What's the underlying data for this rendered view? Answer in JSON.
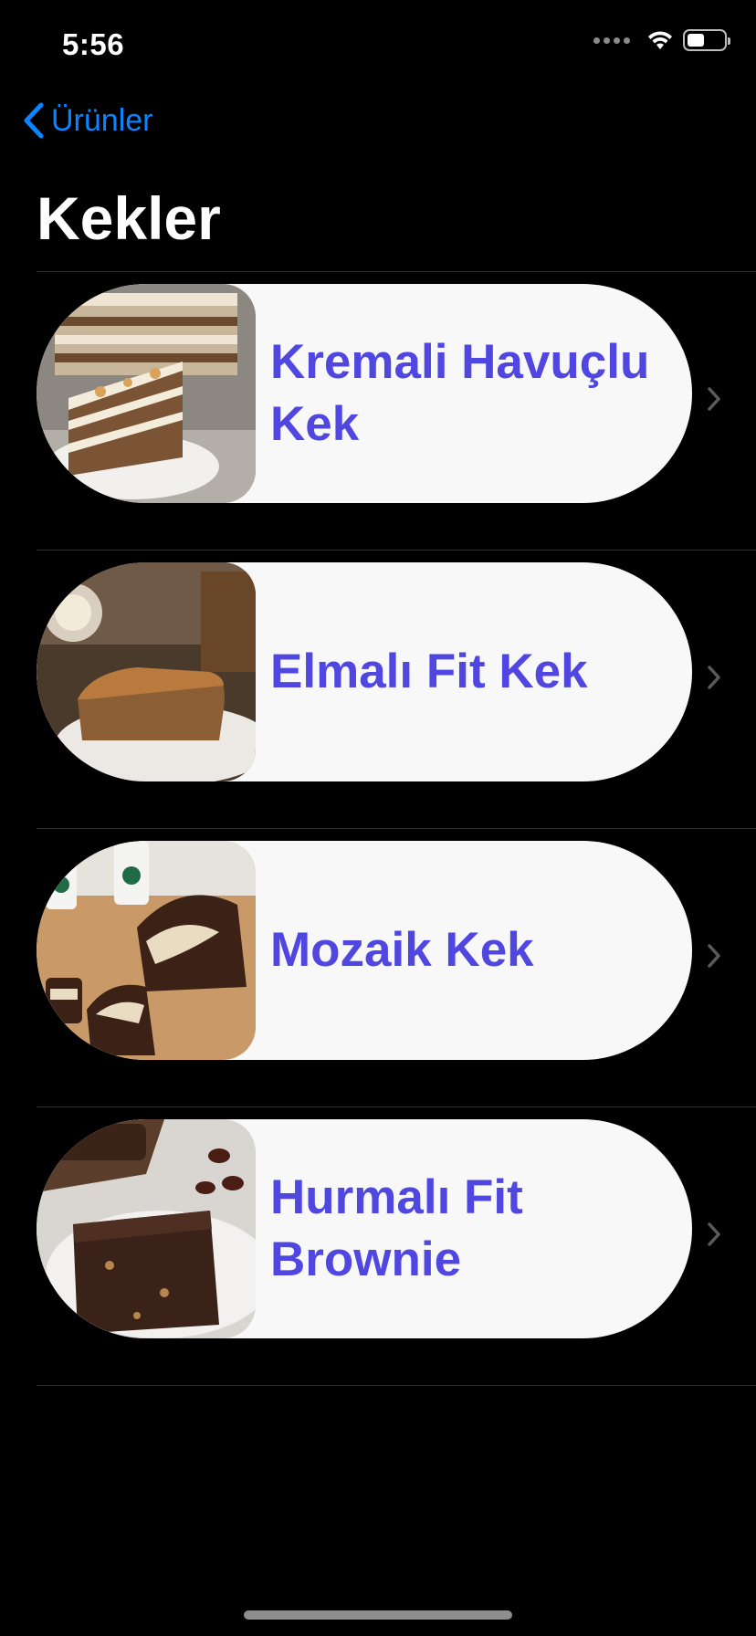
{
  "status_bar": {
    "time": "5:56"
  },
  "nav": {
    "back_label": "Ürünler"
  },
  "page": {
    "title": "Kekler"
  },
  "items": [
    {
      "name": "Kremali Havuçlu Kek",
      "image": "carrot-cake-image"
    },
    {
      "name": "Elmalı Fit Kek",
      "image": "apple-cake-image"
    },
    {
      "name": "Mozaik Kek",
      "image": "mosaic-cake-image"
    },
    {
      "name": "Hurmalı Fit Brownie",
      "image": "date-brownie-image"
    }
  ],
  "colors": {
    "background": "#000000",
    "accent": "#0a84ff",
    "item_title": "#5046e0",
    "card": "#f8f8f8",
    "separator": "#2e2e2e"
  }
}
